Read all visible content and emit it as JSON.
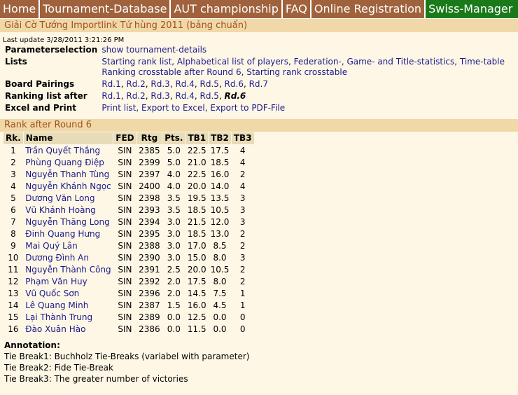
{
  "nav": [
    "Home",
    "Tournament-Database",
    "AUT championship",
    "FAQ",
    "Online Registration",
    "Swiss-Manager"
  ],
  "tournament_title": "Giải Cờ Tướng Importlink Tứ hùng 2011 (bảng chuẩn)",
  "last_update": "Last update 3/28/2011 3:21:26 PM",
  "params": {
    "parameter_label": "Parameterselection",
    "parameter_link": "show tournament-details",
    "lists_label": "Lists",
    "lists_line1": "Starting rank list, Alphabetical list of players, Federation-, Game- and Title-statistics, Time-table",
    "lists_line2": "Ranking crosstable after Round 6, Starting rank crosstable",
    "pairings_label": "Board Pairings",
    "pairings": [
      "Rd.1",
      "Rd.2",
      "Rd.3",
      "Rd.4",
      "Rd.5",
      "Rd.6",
      "Rd.7"
    ],
    "ranking_label": "Ranking list after",
    "ranking_rounds": [
      "Rd.1",
      "Rd.2",
      "Rd.3",
      "Rd.4",
      "Rd.5"
    ],
    "ranking_current": "Rd.6",
    "excel_label": "Excel and Print",
    "excel_links": "Print list, Export to Excel, Export to PDF-File"
  },
  "rank_title": "Rank after Round 6",
  "table_headers": [
    "Rk.",
    "Name",
    "FED",
    "Rtg",
    "Pts.",
    "TB1",
    "TB2",
    "TB3"
  ],
  "rows": [
    [
      "1",
      "Trần Quyết Thắng",
      "SIN",
      "2385",
      "5.0",
      "22.5",
      "17.5",
      "4"
    ],
    [
      "2",
      "Phùng Quang Điệp",
      "SIN",
      "2399",
      "5.0",
      "21.0",
      "18.5",
      "4"
    ],
    [
      "3",
      "Nguyễn Thanh Tùng",
      "SIN",
      "2397",
      "4.0",
      "22.5",
      "16.0",
      "2"
    ],
    [
      "4",
      "Nguyễn Khánh Ngọc",
      "SIN",
      "2400",
      "4.0",
      "20.0",
      "14.0",
      "4"
    ],
    [
      "5",
      "Dương Văn Long",
      "SIN",
      "2398",
      "3.5",
      "19.5",
      "13.5",
      "3"
    ],
    [
      "6",
      "Vũ Khánh Hoàng",
      "SIN",
      "2393",
      "3.5",
      "18.5",
      "10.5",
      "3"
    ],
    [
      "7",
      "Nguyễn Thăng Long",
      "SIN",
      "2394",
      "3.0",
      "21.5",
      "12.0",
      "3"
    ],
    [
      "8",
      "Đinh Quang Hưng",
      "SIN",
      "2395",
      "3.0",
      "18.5",
      "13.0",
      "2"
    ],
    [
      "9",
      "Mai Quý Lân",
      "SIN",
      "2388",
      "3.0",
      "17.0",
      "8.5",
      "2"
    ],
    [
      "10",
      "Dương Đình An",
      "SIN",
      "2390",
      "3.0",
      "15.0",
      "8.0",
      "3"
    ],
    [
      "11",
      "Nguyễn Thành Công",
      "SIN",
      "2391",
      "2.5",
      "20.0",
      "10.5",
      "2"
    ],
    [
      "12",
      "Phạm Văn Huy",
      "SIN",
      "2392",
      "2.0",
      "17.5",
      "8.0",
      "2"
    ],
    [
      "13",
      "Vũ Quốc Sơn",
      "SIN",
      "2396",
      "2.0",
      "14.5",
      "7.5",
      "1"
    ],
    [
      "14",
      "Lê Quang Minh",
      "SIN",
      "2387",
      "1.5",
      "16.0",
      "4.5",
      "1"
    ],
    [
      "15",
      "Lại Thành Trung",
      "SIN",
      "2389",
      "0.0",
      "12.5",
      "0.0",
      "0"
    ],
    [
      "16",
      "Đào Xuân Hào",
      "SIN",
      "2386",
      "0.0",
      "11.5",
      "0.0",
      "0"
    ]
  ],
  "annotation": {
    "title": "Annotation:",
    "lines": [
      "Tie Break1: Buchholz Tie-Breaks (variabel with parameter)",
      "Tie Break2: Fide Tie-Break",
      "Tie Break3: The greater number of victories"
    ]
  },
  "colors": {
    "nav_bg": "#a0623c",
    "swiss_manager_bg": "#1a7a1a",
    "section_bar_bg": "#f0d8a8",
    "section_bar_text": "#a0521a",
    "page_bg": "#fff7e6",
    "link": "#1a1a8c"
  }
}
